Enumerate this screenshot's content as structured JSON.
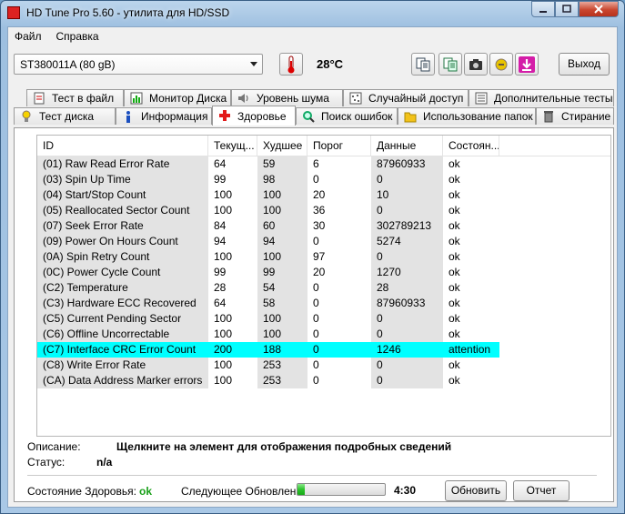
{
  "window": {
    "title": "HD Tune Pro 5.60 - утилита для HD/SSD"
  },
  "menu": [
    {
      "label": "Файл"
    },
    {
      "label": "Справка"
    }
  ],
  "toolbar": {
    "drive": "ST380011A (80 gB)",
    "temperature": "28°C",
    "exit_label": "Выход"
  },
  "tabs_row1": [
    {
      "label": "Тест в файл",
      "icon": "file-test-icon"
    },
    {
      "label": "Монитор Диска",
      "icon": "disk-monitor-icon"
    },
    {
      "label": "Уровень шума",
      "icon": "speaker-icon"
    },
    {
      "label": "Случайный доступ",
      "icon": "random-access-icon"
    },
    {
      "label": "Дополнительные  тесты",
      "icon": "extra-tests-icon"
    }
  ],
  "tabs_row2": [
    {
      "label": "Тест диска",
      "icon": "benchmark-icon"
    },
    {
      "label": "Информация",
      "icon": "info-icon"
    },
    {
      "label": "Здоровье",
      "icon": "health-cross-icon",
      "active": true
    },
    {
      "label": "Поиск ошибок",
      "icon": "magnifier-icon"
    },
    {
      "label": "Использование папок",
      "icon": "folder-icon"
    },
    {
      "label": "Стирание",
      "icon": "trash-icon"
    }
  ],
  "table": {
    "columns": [
      "ID",
      "Текущ...",
      "Худшее",
      "Порог",
      "Данные",
      "Состоян..."
    ],
    "rows": [
      [
        "(01) Raw Read Error Rate",
        "64",
        "59",
        "6",
        "87960933",
        "ok"
      ],
      [
        "(03) Spin Up Time",
        "99",
        "98",
        "0",
        "0",
        "ok"
      ],
      [
        "(04) Start/Stop Count",
        "100",
        "100",
        "20",
        "10",
        "ok"
      ],
      [
        "(05) Reallocated Sector Count",
        "100",
        "100",
        "36",
        "0",
        "ok"
      ],
      [
        "(07) Seek Error Rate",
        "84",
        "60",
        "30",
        "302789213",
        "ok"
      ],
      [
        "(09) Power On Hours Count",
        "94",
        "94",
        "0",
        "5274",
        "ok"
      ],
      [
        "(0A) Spin Retry Count",
        "100",
        "100",
        "97",
        "0",
        "ok"
      ],
      [
        "(0C) Power Cycle Count",
        "99",
        "99",
        "20",
        "1270",
        "ok"
      ],
      [
        "(C2) Temperature",
        "28",
        "54",
        "0",
        "28",
        "ok"
      ],
      [
        "(C3) Hardware ECC Recovered",
        "64",
        "58",
        "0",
        "87960933",
        "ok"
      ],
      [
        "(C5) Current Pending Sector",
        "100",
        "100",
        "0",
        "0",
        "ok"
      ],
      [
        "(C6) Offline Uncorrectable",
        "100",
        "100",
        "0",
        "0",
        "ok"
      ],
      [
        "(C7) Interface CRC Error Count",
        "200",
        "188",
        "0",
        "1246",
        "attention"
      ],
      [
        "(C8) Write Error Rate",
        "100",
        "253",
        "0",
        "0",
        "ok"
      ],
      [
        "(CA) Data Address Marker errors",
        "100",
        "253",
        "0",
        "0",
        "ok"
      ]
    ],
    "highlight_color": "#00ffff"
  },
  "footer": {
    "description_label": "Описание:",
    "description_value": "Щелкните на элемент для отображения подробных сведений",
    "status_label": "Статус:",
    "status_value": "n/a",
    "health_label": "Состояние Здоровья:",
    "health_value": "ok",
    "next_update_label": "Следующее Обновление:",
    "next_update_progress": 0.08,
    "next_update_time": "4:30",
    "refresh_label": "Обновить",
    "report_label": "Отчет"
  }
}
